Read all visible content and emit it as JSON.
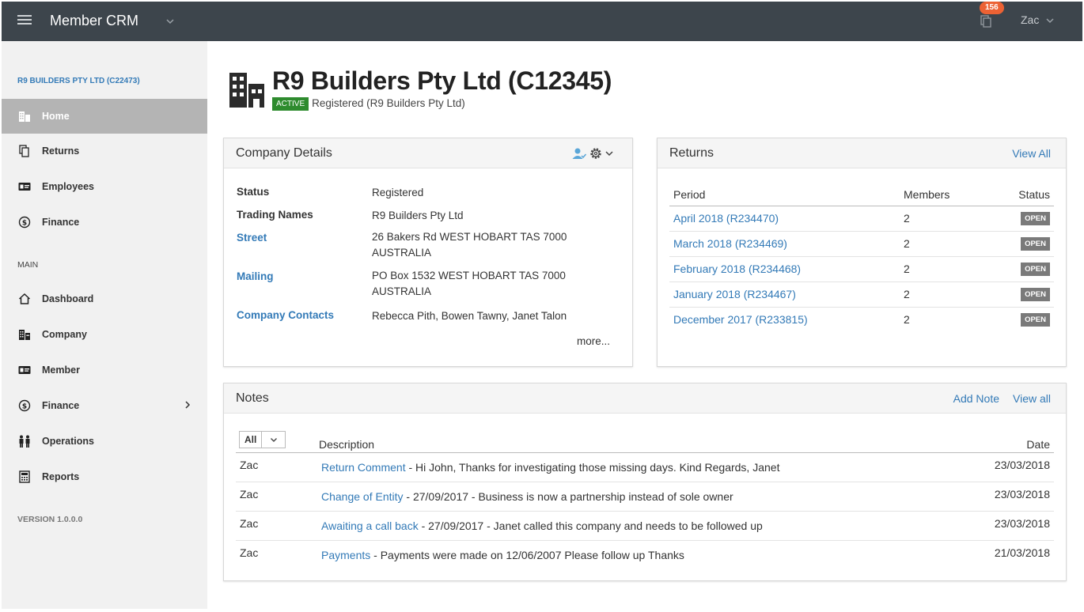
{
  "topbar": {
    "app_title": "Member CRM",
    "notification_count": "156",
    "user": "Zac"
  },
  "sidebar": {
    "org_name": "R9 BUILDERS PTY LTD (C22473)",
    "top_items": [
      {
        "label": "Home",
        "icon": "building-icon"
      },
      {
        "label": "Returns",
        "icon": "copy-icon"
      },
      {
        "label": "Employees",
        "icon": "id-card-icon"
      },
      {
        "label": "Finance",
        "icon": "dollar-icon"
      }
    ],
    "section_label": "MAIN",
    "main_items": [
      {
        "label": "Dashboard",
        "icon": "home-icon"
      },
      {
        "label": "Company",
        "icon": "building-icon"
      },
      {
        "label": "Member",
        "icon": "id-card-icon"
      },
      {
        "label": "Finance",
        "icon": "dollar-icon"
      },
      {
        "label": "Operations",
        "icon": "people-icon"
      },
      {
        "label": "Reports",
        "icon": "calculator-icon"
      }
    ],
    "version": "VERSION 1.0.0.0"
  },
  "header": {
    "title": "R9 Builders Pty Ltd (C12345)",
    "badge": "ACTIVE",
    "status_text": "Registered (R9 Builders Pty Ltd)"
  },
  "company_details": {
    "title": "Company Details",
    "rows": [
      {
        "label": "Status",
        "value": "Registered"
      },
      {
        "label": "Trading Names",
        "value": "R9 Builders Pty Ltd"
      },
      {
        "label": "Street",
        "value": "26 Bakers Rd WEST HOBART TAS 7000 AUSTRALIA"
      },
      {
        "label": "Mailing",
        "value": "PO Box 1532 WEST HOBART TAS 7000 AUSTRALIA"
      },
      {
        "label": "Company Contacts",
        "value": "Rebecca Pith, Bowen Tawny, Janet Talon"
      }
    ],
    "more": "more..."
  },
  "returns": {
    "title": "Returns",
    "view_all": "View All",
    "columns": [
      "Period",
      "Members",
      "Status"
    ],
    "rows": [
      {
        "period": "April 2018 (R234470)",
        "members": "2",
        "status": "OPEN"
      },
      {
        "period": "March 2018 (R234469)",
        "members": "2",
        "status": "OPEN"
      },
      {
        "period": "February 2018 (R234468)",
        "members": "2",
        "status": "OPEN"
      },
      {
        "period": "January 2018 (R234467)",
        "members": "2",
        "status": "OPEN"
      },
      {
        "period": "December 2017 (R233815)",
        "members": "2",
        "status": "OPEN"
      }
    ]
  },
  "notes": {
    "title": "Notes",
    "add_note": "Add Note",
    "view_all": "View all",
    "filter": "All",
    "columns": [
      "Description",
      "Date"
    ],
    "rows": [
      {
        "user": "Zac",
        "type": "Return Comment",
        "text": " - Hi John, Thanks for investigating those missing days. Kind Regards, Janet",
        "date": "23/03/2018"
      },
      {
        "user": "Zac",
        "type": "Change of Entity",
        "text": " - 27/09/2017 - Business is now a partnership instead of sole owner",
        "date": "23/03/2018"
      },
      {
        "user": "Zac",
        "type": "Awaiting a call back",
        "text": " - 27/09/2017 - Janet called this company and needs to be followed up",
        "date": "23/03/2018"
      },
      {
        "user": "Zac",
        "type": "Payments",
        "text": " - Payments were made on 12/06/2007 Please follow up Thanks",
        "date": "21/03/2018"
      }
    ]
  }
}
